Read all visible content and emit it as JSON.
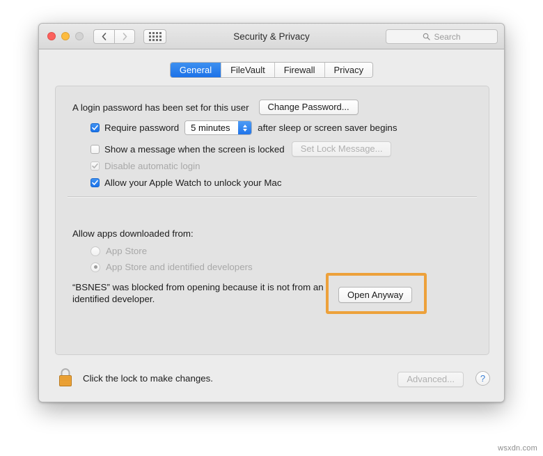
{
  "window": {
    "title": "Security & Privacy",
    "traffic_lights": [
      "close",
      "minimize",
      "zoom"
    ],
    "nav": {
      "back": "‹",
      "forward": "›",
      "grid": "show-all-grid"
    },
    "search": {
      "placeholder": "Search",
      "value": ""
    }
  },
  "tabs": [
    {
      "label": "General",
      "active": true
    },
    {
      "label": "FileVault",
      "active": false
    },
    {
      "label": "Firewall",
      "active": false
    },
    {
      "label": "Privacy",
      "active": false
    }
  ],
  "general": {
    "login_password_text": "A login password has been set for this user",
    "change_password_button": "Change Password...",
    "require_password": {
      "label": "Require password",
      "checked": true,
      "delay_value": "5 minutes",
      "suffix": "after sleep or screen saver begins"
    },
    "show_message": {
      "label": "Show a message when the screen is locked",
      "checked": false,
      "button": "Set Lock Message...",
      "button_disabled": true
    },
    "disable_automatic_login": {
      "label": "Disable automatic login",
      "checked": true,
      "disabled": true
    },
    "apple_watch": {
      "label": "Allow your Apple Watch to unlock your Mac",
      "checked": true
    }
  },
  "gatekeeper": {
    "heading": "Allow apps downloaded from:",
    "options": [
      {
        "label": "App Store",
        "selected": false,
        "disabled": true
      },
      {
        "label": "App Store and identified developers",
        "selected": true,
        "disabled": true
      }
    ],
    "blocked_message": "“BSNES” was blocked from opening because it is not from an identified developer.",
    "open_anyway_button": "Open Anyway",
    "highlight_color": "#eda13b"
  },
  "footer": {
    "lock_icon": "closed-padlock",
    "lock_text": "Click the lock to make changes.",
    "advanced_button": "Advanced...",
    "advanced_disabled": true,
    "help_button": "?"
  },
  "watermark": "wsxdn.com"
}
